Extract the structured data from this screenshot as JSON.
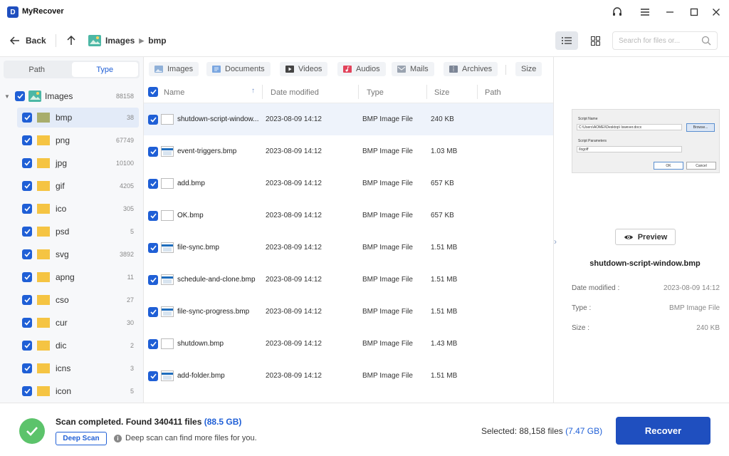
{
  "app": {
    "title": "MyRecover",
    "logo_letter": "D"
  },
  "toolbar": {
    "back_label": "Back",
    "breadcrumb": [
      "Images",
      "bmp"
    ],
    "search_placeholder": "Search for files or..."
  },
  "sidebar": {
    "tabs": [
      {
        "label": "Path",
        "active": false
      },
      {
        "label": "Type",
        "active": true
      }
    ],
    "root": {
      "label": "Images",
      "count": "88158"
    },
    "items": [
      {
        "label": "bmp",
        "count": "38",
        "selected": true,
        "color": "#a8ad6c"
      },
      {
        "label": "png",
        "count": "67749",
        "selected": false,
        "color": "#f5c443"
      },
      {
        "label": "jpg",
        "count": "10100",
        "selected": false,
        "color": "#f5c443"
      },
      {
        "label": "gif",
        "count": "4205",
        "selected": false,
        "color": "#f5c443"
      },
      {
        "label": "ico",
        "count": "305",
        "selected": false,
        "color": "#f5c443"
      },
      {
        "label": "psd",
        "count": "5",
        "selected": false,
        "color": "#f5c443"
      },
      {
        "label": "svg",
        "count": "3892",
        "selected": false,
        "color": "#f5c443"
      },
      {
        "label": "apng",
        "count": "11",
        "selected": false,
        "color": "#f5c443"
      },
      {
        "label": "cso",
        "count": "27",
        "selected": false,
        "color": "#f5c443"
      },
      {
        "label": "cur",
        "count": "30",
        "selected": false,
        "color": "#f5c443"
      },
      {
        "label": "dic",
        "count": "2",
        "selected": false,
        "color": "#f5c443"
      },
      {
        "label": "icns",
        "count": "3",
        "selected": false,
        "color": "#f5c443"
      },
      {
        "label": "icon",
        "count": "5",
        "selected": false,
        "color": "#f5c443"
      }
    ]
  },
  "filters": [
    {
      "label": "Images",
      "icon": "image-icon",
      "color": "#8fb0d8"
    },
    {
      "label": "Documents",
      "icon": "document-icon",
      "color": "#7aa6e0"
    },
    {
      "label": "Videos",
      "icon": "video-icon",
      "color": "#444444"
    },
    {
      "label": "Audios",
      "icon": "audio-icon",
      "color": "#e2435b"
    },
    {
      "label": "Mails",
      "icon": "mail-icon",
      "color": "#9aa3b0"
    },
    {
      "label": "Archives",
      "icon": "archive-icon",
      "color": "#7d8696"
    },
    {
      "label": "Size",
      "icon": "",
      "color": ""
    }
  ],
  "table": {
    "headers": {
      "name": "Name",
      "date": "Date modified",
      "type": "Type",
      "size": "Size",
      "path": "Path"
    },
    "rows": [
      {
        "name": "shutdown-script-window...",
        "date": "2023-08-09 14:12",
        "type": "BMP Image File",
        "size": "240 KB",
        "thumb": "light",
        "selected": true
      },
      {
        "name": "event-triggers.bmp",
        "date": "2023-08-09 14:12",
        "type": "BMP Image File",
        "size": "1.03 MB",
        "thumb": "dark",
        "selected": false
      },
      {
        "name": "add.bmp",
        "date": "2023-08-09 14:12",
        "type": "BMP Image File",
        "size": "657 KB",
        "thumb": "light",
        "selected": false
      },
      {
        "name": "OK.bmp",
        "date": "2023-08-09 14:12",
        "type": "BMP Image File",
        "size": "657 KB",
        "thumb": "light",
        "selected": false
      },
      {
        "name": "file-sync.bmp",
        "date": "2023-08-09 14:12",
        "type": "BMP Image File",
        "size": "1.51 MB",
        "thumb": "dark",
        "selected": false
      },
      {
        "name": "schedule-and-clone.bmp",
        "date": "2023-08-09 14:12",
        "type": "BMP Image File",
        "size": "1.51 MB",
        "thumb": "dark",
        "selected": false
      },
      {
        "name": "file-sync-progress.bmp",
        "date": "2023-08-09 14:12",
        "type": "BMP Image File",
        "size": "1.51 MB",
        "thumb": "dark",
        "selected": false
      },
      {
        "name": "shutdown.bmp",
        "date": "2023-08-09 14:12",
        "type": "BMP Image File",
        "size": "1.43 MB",
        "thumb": "light",
        "selected": false
      },
      {
        "name": "add-folder.bmp",
        "date": "2023-08-09 14:12",
        "type": "BMP Image File",
        "size": "1.51 MB",
        "thumb": "dark",
        "selected": false
      }
    ]
  },
  "preview": {
    "dialog": {
      "script_name_label": "Script Name",
      "script_name_value": "C:\\Users\\AOMEI\\Desktop\\ lswever.docx",
      "browse_label": "Browse...",
      "params_label": "Script Parameters",
      "params_value": "/logoff",
      "ok_label": "OK",
      "cancel_label": "Cancel"
    },
    "button_label": "Preview",
    "file_name": "shutdown-script-window.bmp",
    "details": [
      {
        "label": "Date modified :",
        "value": "2023-08-09 14:12"
      },
      {
        "label": "Type :",
        "value": "BMP Image File"
      },
      {
        "label": "Size :",
        "value": "240 KB"
      }
    ]
  },
  "footer": {
    "scan_message": "Scan completed. Found 340411 files",
    "scan_size": "(88.5 GB)",
    "deep_scan_label": "Deep Scan",
    "deep_scan_hint": "Deep scan can find more files for you.",
    "selected_text": "Selected: 88,158 files",
    "selected_size": "(7.47 GB)",
    "recover_label": "Recover"
  },
  "colors": {
    "accent": "#1f5fd6",
    "primary_button": "#1f4fbf",
    "success": "#5cc36b"
  }
}
